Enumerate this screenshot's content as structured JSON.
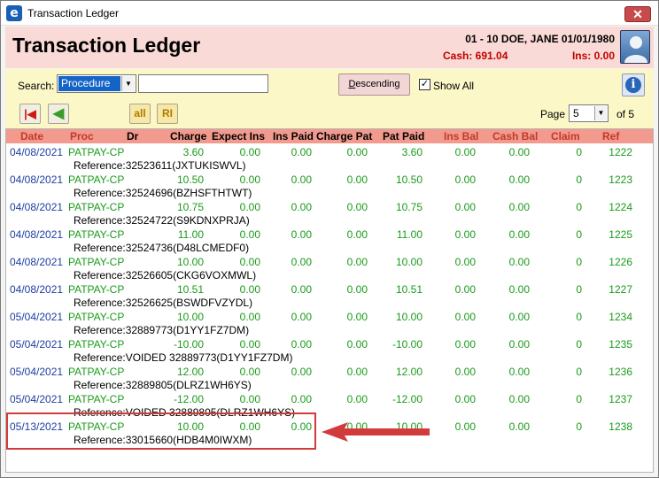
{
  "window": {
    "title": "Transaction Ledger",
    "app_icon_glyph": "e",
    "close_glyph": "✕"
  },
  "header": {
    "title": "Transaction Ledger",
    "patient": "01 - 10 DOE, JANE 01/01/1980",
    "cash": "Cash: 691.04",
    "ins": "Ins: 0.00"
  },
  "controls": {
    "search_label": "Search:",
    "search_field": "Procedure",
    "search_value": "",
    "sort_prefix": "D",
    "sort_rest": "escending",
    "show_all_label": "Show All",
    "show_all_checked": "✓",
    "info_glyph": "i"
  },
  "toolbar": {
    "first_glyph": "|◀",
    "back_glyph": "◀",
    "all_label": "all",
    "r_label": "RI",
    "page_label": "Page",
    "page_value": "5",
    "of_label": "of 5"
  },
  "columns": {
    "date": "Date",
    "proc": "Proc",
    "dr": "Dr",
    "charge": "Charge",
    "expect_ins": "Expect Ins",
    "ins_paid": "Ins Paid",
    "charge_pat": "Charge Pat",
    "pat_paid": "Pat Paid",
    "ins_bal": "Ins Bal",
    "cash_bal": "Cash Bal",
    "claim": "Claim",
    "ref": "Ref"
  },
  "rows": [
    {
      "date": "04/08/2021",
      "proc": "PATPAY-CP",
      "charge": "3.60",
      "expect_ins": "0.00",
      "ins_paid": "0.00",
      "charge_pat": "0.00",
      "pat_paid": "3.60",
      "ins_bal": "0.00",
      "cash_bal": "0.00",
      "claim": "0",
      "ref": "1222",
      "reference": "Reference:32523611(JXTUKISWVL)"
    },
    {
      "date": "04/08/2021",
      "proc": "PATPAY-CP",
      "charge": "10.50",
      "expect_ins": "0.00",
      "ins_paid": "0.00",
      "charge_pat": "0.00",
      "pat_paid": "10.50",
      "ins_bal": "0.00",
      "cash_bal": "0.00",
      "claim": "0",
      "ref": "1223",
      "reference": "Reference:32524696(BZHSFTHTWT)"
    },
    {
      "date": "04/08/2021",
      "proc": "PATPAY-CP",
      "charge": "10.75",
      "expect_ins": "0.00",
      "ins_paid": "0.00",
      "charge_pat": "0.00",
      "pat_paid": "10.75",
      "ins_bal": "0.00",
      "cash_bal": "0.00",
      "claim": "0",
      "ref": "1224",
      "reference": "Reference:32524722(S9KDNXPRJA)"
    },
    {
      "date": "04/08/2021",
      "proc": "PATPAY-CP",
      "charge": "11.00",
      "expect_ins": "0.00",
      "ins_paid": "0.00",
      "charge_pat": "0.00",
      "pat_paid": "11.00",
      "ins_bal": "0.00",
      "cash_bal": "0.00",
      "claim": "0",
      "ref": "1225",
      "reference": "Reference:32524736(D48LCMEDF0)"
    },
    {
      "date": "04/08/2021",
      "proc": "PATPAY-CP",
      "charge": "10.00",
      "expect_ins": "0.00",
      "ins_paid": "0.00",
      "charge_pat": "0.00",
      "pat_paid": "10.00",
      "ins_bal": "0.00",
      "cash_bal": "0.00",
      "claim": "0",
      "ref": "1226",
      "reference": "Reference:32526605(CKG6VOXMWL)"
    },
    {
      "date": "04/08/2021",
      "proc": "PATPAY-CP",
      "charge": "10.51",
      "expect_ins": "0.00",
      "ins_paid": "0.00",
      "charge_pat": "0.00",
      "pat_paid": "10.51",
      "ins_bal": "0.00",
      "cash_bal": "0.00",
      "claim": "0",
      "ref": "1227",
      "reference": "Reference:32526625(BSWDFVZYDL)"
    },
    {
      "date": "05/04/2021",
      "proc": "PATPAY-CP",
      "charge": "10.00",
      "expect_ins": "0.00",
      "ins_paid": "0.00",
      "charge_pat": "0.00",
      "pat_paid": "10.00",
      "ins_bal": "0.00",
      "cash_bal": "0.00",
      "claim": "0",
      "ref": "1234",
      "reference": "Reference:32889773(D1YY1FZ7DM)"
    },
    {
      "date": "05/04/2021",
      "proc": "PATPAY-CP",
      "charge": "-10.00",
      "expect_ins": "0.00",
      "ins_paid": "0.00",
      "charge_pat": "0.00",
      "pat_paid": "-10.00",
      "ins_bal": "0.00",
      "cash_bal": "0.00",
      "claim": "0",
      "ref": "1235",
      "reference": "Reference:VOIDED 32889773(D1YY1FZ7DM)"
    },
    {
      "date": "05/04/2021",
      "proc": "PATPAY-CP",
      "charge": "12.00",
      "expect_ins": "0.00",
      "ins_paid": "0.00",
      "charge_pat": "0.00",
      "pat_paid": "12.00",
      "ins_bal": "0.00",
      "cash_bal": "0.00",
      "claim": "0",
      "ref": "1236",
      "reference": "Reference:32889805(DLRZ1WH6YS)"
    },
    {
      "date": "05/04/2021",
      "proc": "PATPAY-CP",
      "charge": "-12.00",
      "expect_ins": "0.00",
      "ins_paid": "0.00",
      "charge_pat": "0.00",
      "pat_paid": "-12.00",
      "ins_bal": "0.00",
      "cash_bal": "0.00",
      "claim": "0",
      "ref": "1237",
      "reference": "Reference:VOIDED 32889805(DLRZ1WH6YS)"
    },
    {
      "date": "05/13/2021",
      "proc": "PATPAY-CP",
      "charge": "10.00",
      "expect_ins": "0.00",
      "ins_paid": "0.00",
      "charge_pat": "0.00",
      "pat_paid": "10.00",
      "ins_bal": "0.00",
      "cash_bal": "0.00",
      "claim": "0",
      "ref": "1238",
      "reference": "Reference:33015660(HDB4M0IWXM)"
    }
  ],
  "colors": {
    "header_bg": "#fadad6",
    "controls_bg": "#fbf7c7",
    "column_header_bg": "#f29a8d",
    "date_text": "#1d3ea0",
    "amount_text": "#1a9a1a",
    "money_alert": "#c00000",
    "callout": "#d23b3b"
  }
}
